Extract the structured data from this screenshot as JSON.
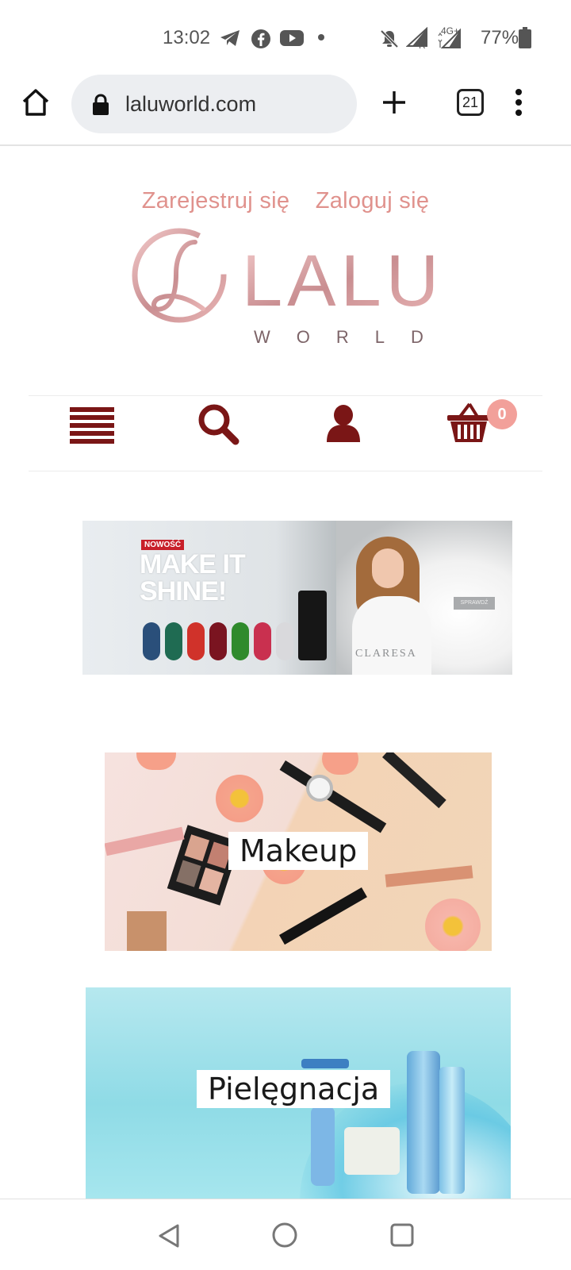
{
  "status_bar": {
    "time": "13:02",
    "battery": "77%",
    "network": "4G+",
    "roaming": "R",
    "icons": [
      "telegram-icon",
      "facebook-icon",
      "youtube-icon",
      "notification-dot-icon",
      "bell-off-icon",
      "signal-icon",
      "signal-icon",
      "battery-icon"
    ]
  },
  "browser": {
    "url": "laluworld.com",
    "tab_count": "21"
  },
  "header": {
    "register_label": "Zarejestruj się",
    "login_label": "Zaloguj się",
    "logo_main": "LALU",
    "logo_sub": "WORLD"
  },
  "nav_icons": {
    "cart_count": "0"
  },
  "promo_banner": {
    "badge": "NOWOŚĆ",
    "headline_line1": "MAKE IT",
    "headline_line2": "SHINE!",
    "cta": "SPRAWDŹ",
    "brand": "CLARESA"
  },
  "categories": [
    {
      "label": "Makeup"
    },
    {
      "label": "Pielęgnacja"
    }
  ],
  "colors": {
    "accent": "#e0928d",
    "brand_dark_red": "#7a1616",
    "badge": "#f2a09a",
    "logo_rose": "#d9a3a6"
  }
}
